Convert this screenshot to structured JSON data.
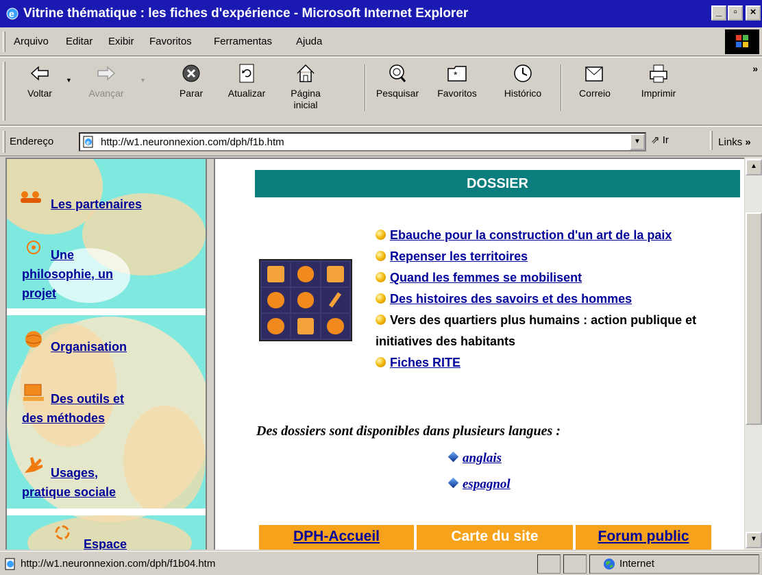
{
  "window": {
    "title": "Vitrine thématique : les fiches d'expérience - Microsoft Internet Explorer",
    "controls": {
      "minimize": "_",
      "maximize": "▫",
      "close": "×"
    }
  },
  "menu": [
    "Arquivo",
    "Editar",
    "Exibir",
    "Favoritos",
    "Ferramentas",
    "Ajuda"
  ],
  "toolbar": {
    "back": "Voltar",
    "forward": "Avançar",
    "stop": "Parar",
    "refresh": "Atualizar",
    "home": "Página\ninicial",
    "search": "Pesquisar",
    "favorites": "Favoritos",
    "history": "Histórico",
    "mail": "Correio",
    "print": "Imprimir",
    "more": "»"
  },
  "address": {
    "label": "Endereço",
    "url": "http://w1.neuronnexion.com/dph/f1b.htm",
    "go": "Ir",
    "links": "Links",
    "links_more": "»"
  },
  "sidebar": {
    "items": [
      {
        "label": "Les partenaires"
      },
      {
        "label": "Une\nphilosophie, un\nprojet"
      },
      {
        "label": "Organisation"
      },
      {
        "label": "Des outils et\ndes méthodes"
      },
      {
        "label": "Usages,\npratique sociale"
      },
      {
        "label": "Espace"
      }
    ]
  },
  "main": {
    "heading": "DOSSIER",
    "dossiers": [
      {
        "label": "Ebauche pour la construction d'un art de la paix",
        "link": true
      },
      {
        "label": "Repenser les territoires",
        "link": true
      },
      {
        "label": "Quand les femmes se mobilisent",
        "link": true
      },
      {
        "label": "Des histoires des savoirs et des hommes",
        "link": true
      },
      {
        "label": "Vers des quartiers plus humains : action publique et initiatives des habitants",
        "link": false
      },
      {
        "label": "Fiches RITE",
        "link": true
      }
    ],
    "languages_intro": "Des dossiers sont disponibles dans plusieurs langues :",
    "languages": [
      "anglais",
      "espagnol"
    ],
    "bottom_nav": [
      "DPH-Accueil",
      "Carte du site",
      "Forum public"
    ]
  },
  "status": {
    "url": "http://w1.neuronnexion.com/dph/f1b04.htm",
    "zone": "Internet"
  },
  "colors": {
    "titlebar": "#1a1ab2",
    "dossier_bar": "#0a7d7d",
    "sidebar_bg": "#7fe9e0",
    "link": "#00009a",
    "bottom_nav": "#f7a21b"
  }
}
